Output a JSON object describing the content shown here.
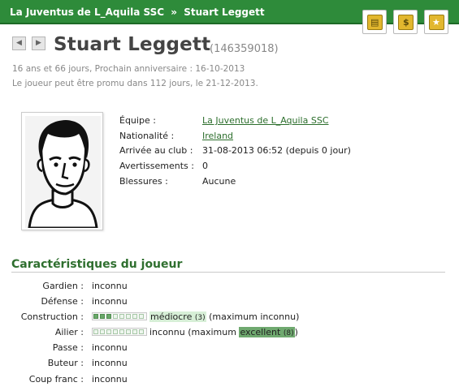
{
  "header": {
    "team_link": "La Juventus de L_Aquila SSC",
    "separator": "»",
    "player_name": "Stuart Leggett"
  },
  "header_buttons": [
    {
      "icon": "transfer-list-icon"
    },
    {
      "icon": "money-icon"
    },
    {
      "icon": "star-icon"
    }
  ],
  "nav": {
    "prev_icon": "◀",
    "next_icon": "▶"
  },
  "player": {
    "name": "Stuart Leggett",
    "id": "(146359018)",
    "age_line": "16 ans et 66 jours, Prochain anniversaire : 16-10-2013",
    "promo_line": "Le joueur peut être promu dans 112 jours, le 21-12-2013."
  },
  "info": {
    "team_label": "Équipe :",
    "team_value": "La Juventus de L_Aquila SSC",
    "nationality_label": "Nationalité :",
    "nationality_value": "Ireland",
    "arrival_label": "Arrivée au club :",
    "arrival_value": "31-08-2013 06:52 (depuis 0 jour)",
    "warnings_label": "Avertissements :",
    "warnings_value": "0",
    "injuries_label": "Blessures :",
    "injuries_value": "Aucune"
  },
  "skills_section": {
    "title": "Caractéristiques du joueur",
    "rows": [
      {
        "label": "Gardien :",
        "value": "inconnu"
      },
      {
        "label": "Défense :",
        "value": "inconnu"
      },
      {
        "label": "Construction :",
        "bar_level": 3,
        "bar_max": 8,
        "level_word": "médiocre",
        "level_num": "(3)",
        "suffix_open": "(maximum ",
        "max_value": "inconnu",
        "suffix_close": ")"
      },
      {
        "label": "Ailier :",
        "bar_level": 0,
        "bar_max": 8,
        "level_word": "inconnu",
        "suffix_open": "(maximum ",
        "max_value": "excellent",
        "max_num": "(8)",
        "suffix_close": ")"
      },
      {
        "label": "Passe :",
        "value": "inconnu"
      },
      {
        "label": "Buteur :",
        "value": "inconnu"
      },
      {
        "label": "Coup franc :",
        "value": "inconnu"
      }
    ]
  },
  "colors": {
    "header_bg": "#2e8b3a",
    "link": "#2c6e2c",
    "section_title": "#2f6f2f",
    "low_level_highlight": "#d7efd7",
    "high_level_highlight": "#6fa96f"
  }
}
